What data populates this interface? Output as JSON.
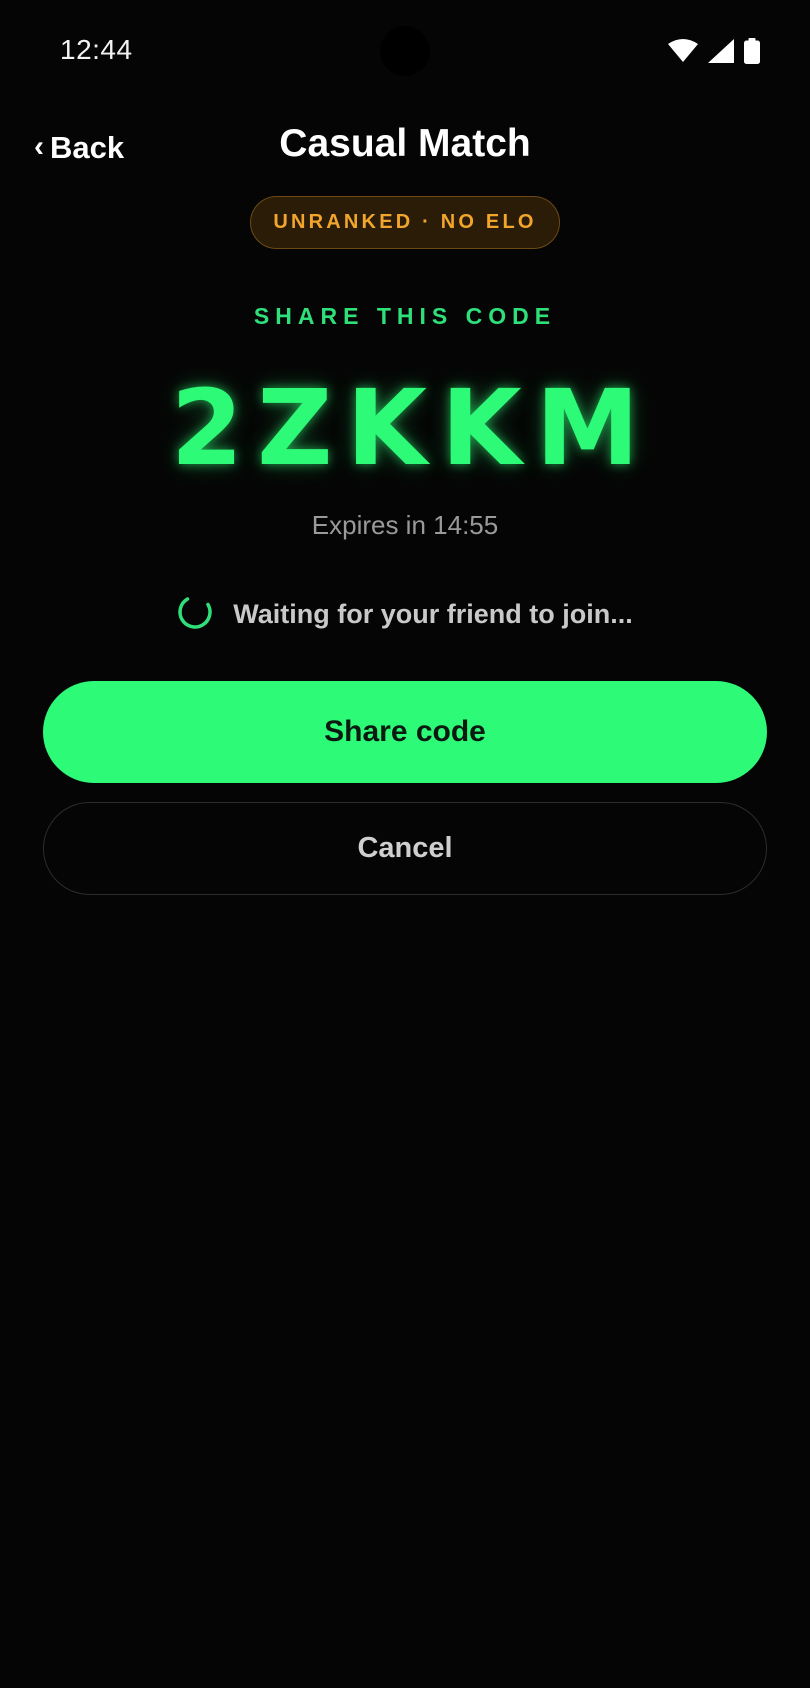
{
  "status_bar": {
    "time": "12:44",
    "icons": [
      "wifi-icon",
      "signal-icon",
      "battery-icon"
    ]
  },
  "header": {
    "back_label": "Back",
    "back_icon": "chevron-left-icon",
    "title": "Casual Match"
  },
  "badge": {
    "label": "UNRANKED · NO ELO"
  },
  "share": {
    "label": "SHARE THIS CODE",
    "code": "2ZKKM",
    "expires_label": "Expires in 14:55"
  },
  "waiting": {
    "icon": "loading-spinner-icon",
    "text": "Waiting for your friend to join..."
  },
  "actions": {
    "share_label": "Share code",
    "cancel_label": "Cancel"
  },
  "colors": {
    "background": "#050505",
    "accent_green": "#2dfa77",
    "badge_amber": "#f2a52b",
    "badge_bg": "#2a1c07"
  }
}
